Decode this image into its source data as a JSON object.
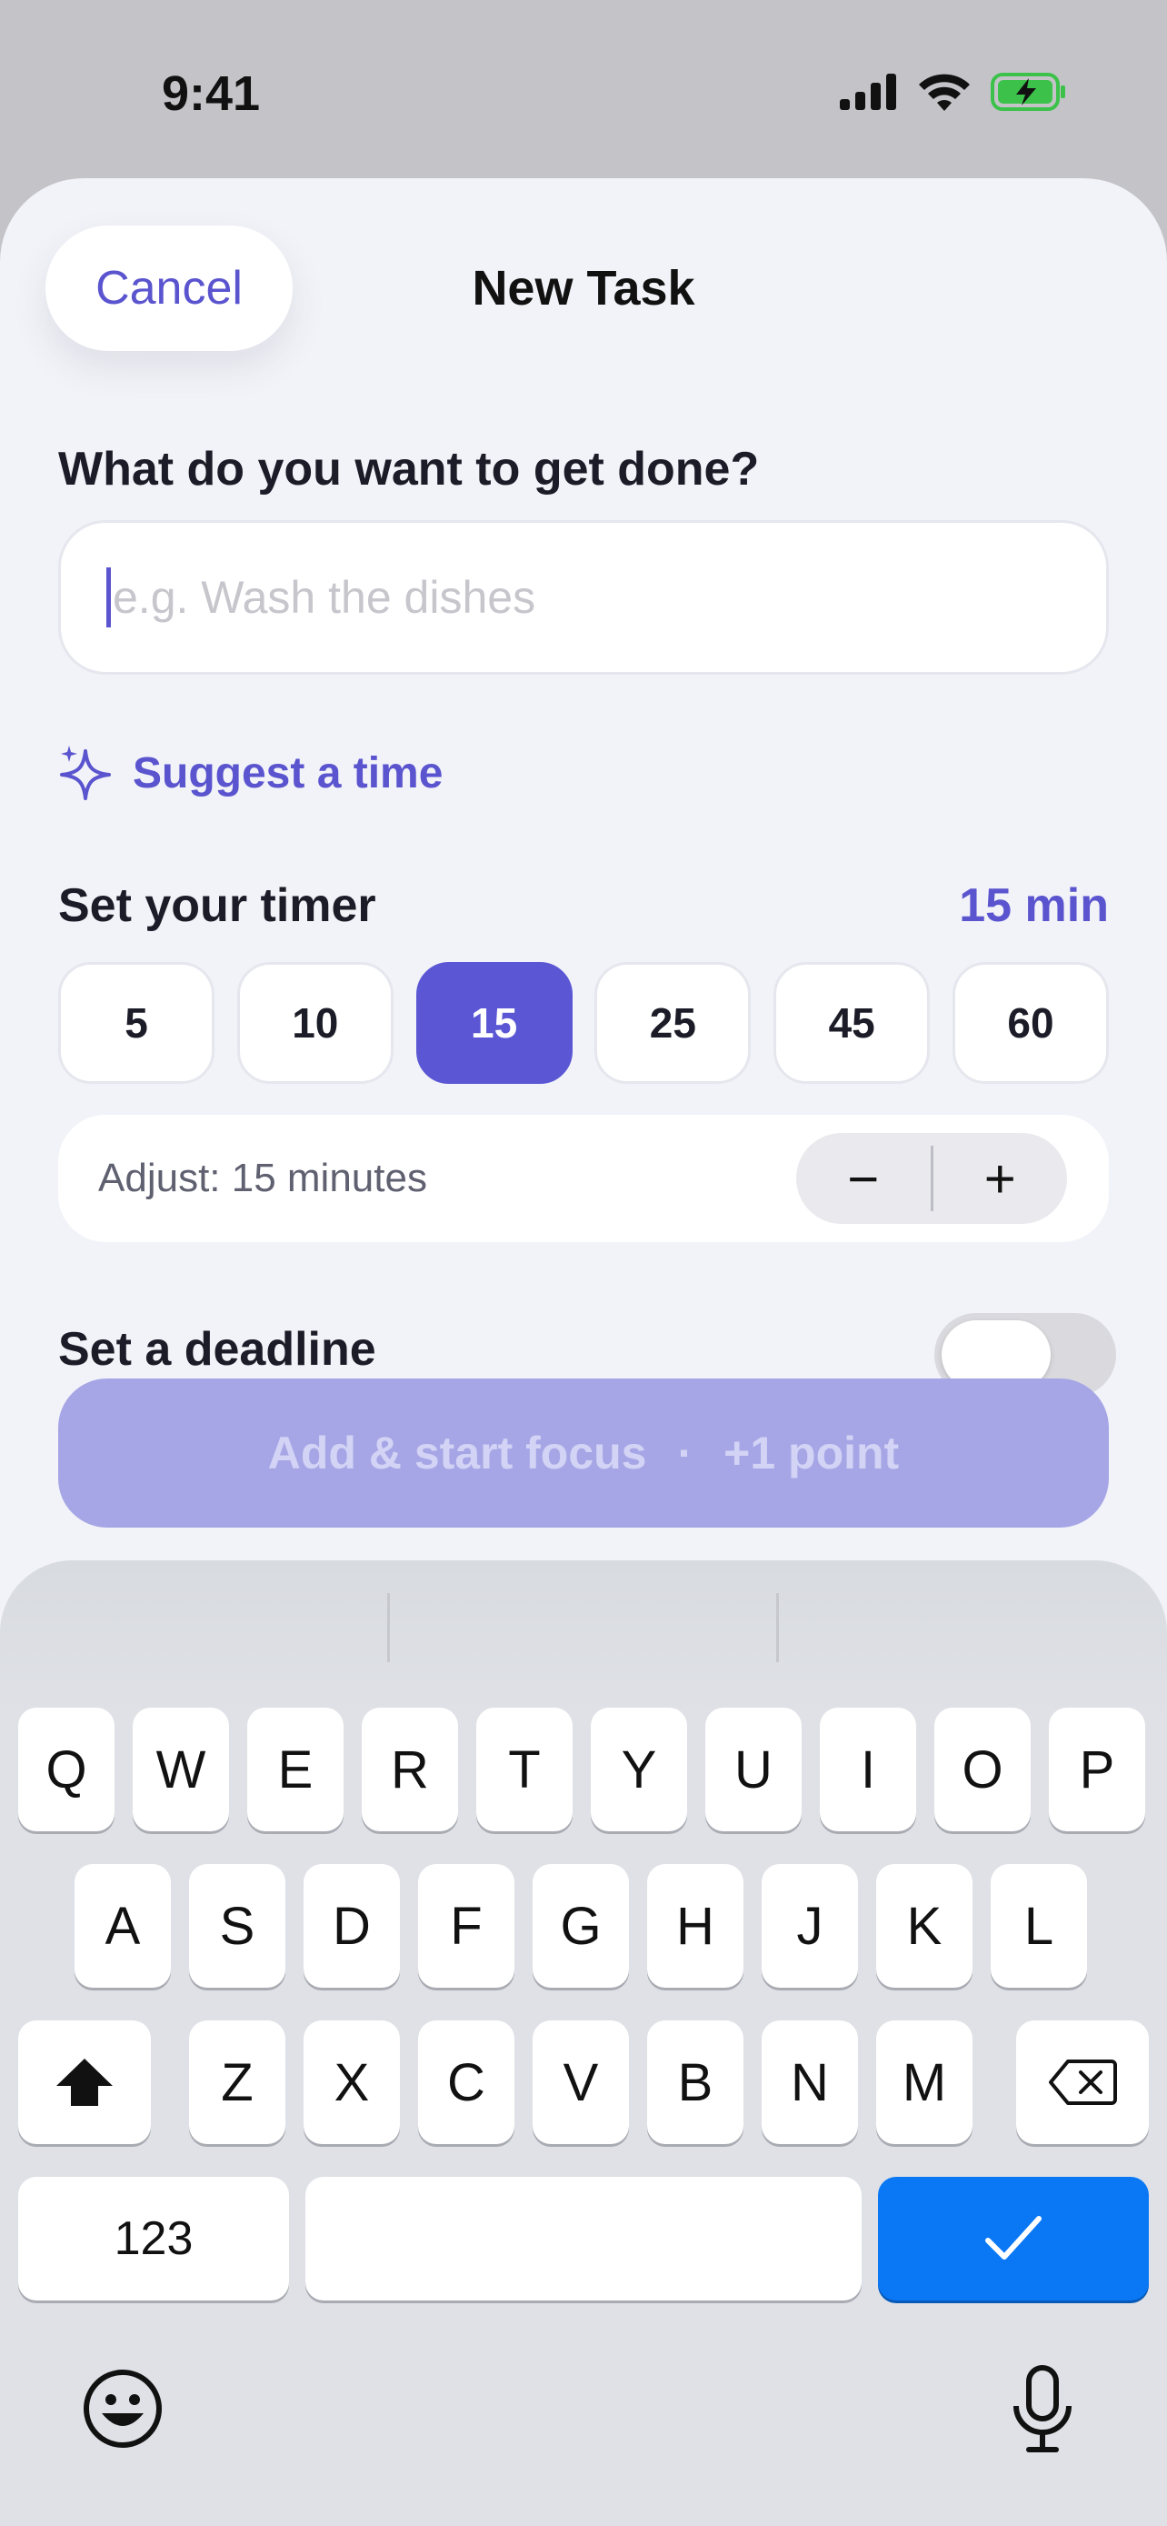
{
  "status": {
    "time": "9:41"
  },
  "header": {
    "cancel_label": "Cancel",
    "title": "New Task"
  },
  "task": {
    "question": "What do you want to get done?",
    "placeholder": "e.g. Wash the dishes",
    "value": ""
  },
  "suggest": {
    "label": "Suggest a time",
    "icon": "sparkle-icon"
  },
  "timer": {
    "label": "Set your timer",
    "value": "15 min",
    "presets": [
      "5",
      "10",
      "15",
      "25",
      "45",
      "60"
    ],
    "selected": "15",
    "adjust_label": "Adjust: 15 minutes",
    "minus": "−",
    "plus": "+"
  },
  "deadline": {
    "label": "Set a deadline",
    "enabled": false
  },
  "cta": {
    "label": "Add & start focus",
    "separator": "·",
    "points": "+1 point"
  },
  "keyboard": {
    "row1": [
      "Q",
      "W",
      "E",
      "R",
      "T",
      "Y",
      "U",
      "I",
      "O",
      "P"
    ],
    "row2": [
      "A",
      "S",
      "D",
      "F",
      "G",
      "H",
      "J",
      "K",
      "L"
    ],
    "row3": [
      "Z",
      "X",
      "C",
      "V",
      "B",
      "N",
      "M"
    ],
    "numbers": "123",
    "done_icon": "checkmark-icon"
  },
  "colors": {
    "accent": "#5b57d4",
    "done_key": "#0a78f5"
  }
}
